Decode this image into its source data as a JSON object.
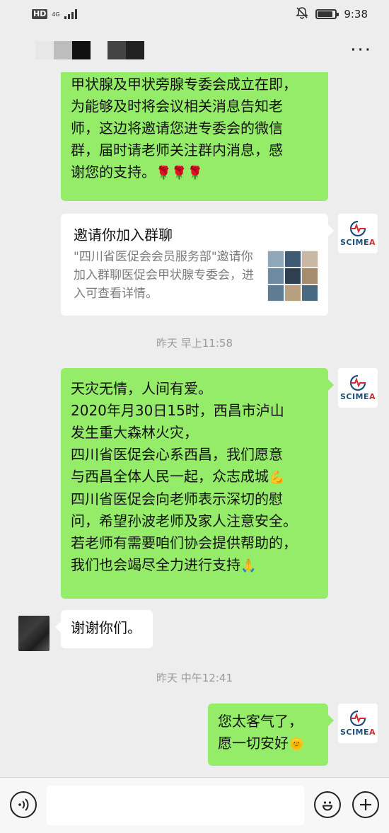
{
  "status_bar": {
    "hd_badge": "HD",
    "network_type": "4G",
    "time": "9:38",
    "battery_level": 0.8,
    "icons": [
      "hd-icon",
      "signal-icon",
      "mute-icon",
      "battery-icon"
    ]
  },
  "header": {
    "title_blurred": true,
    "more_label": "···"
  },
  "avatar_brand": {
    "text_main": "SCIME",
    "text_accent": "A",
    "brand_color": "#1d4f7c",
    "accent_color": "#d22a33"
  },
  "messages": [
    {
      "type": "text",
      "direction": "out",
      "lines": [
        "甲状腺及甲状旁腺专委会成立在即，",
        "为能够及时将会议相关消息告知老",
        "师，这边将邀请您进专委会的微信",
        "群，届时请老师关注群内消息，感",
        "谢您的支持。"
      ],
      "emoji": "🌹🌹🌹"
    },
    {
      "type": "invite_card",
      "direction": "out",
      "title": "邀请你加入群聊",
      "description": "\"四川省医促会会员服务部\"邀请你加入群聊医促会甲状腺专委会，进入可查看详情。"
    },
    {
      "type": "timestamp",
      "text": "昨天 早上11:58"
    },
    {
      "type": "text",
      "direction": "out",
      "lines": [
        "天灾无情，人间有爱。",
        "2020年月30日15时，西昌市泸山",
        "发生重大森林火灾，",
        "四川省医促会心系西昌，我们愿意",
        "与西昌全体人民一起，众志成城",
        "四川省医促会向老师表示深切的慰",
        "问，希望孙波老师及家人注意安全。",
        "若老师有需要咱们协会提供帮助的，",
        "我们也会竭尽全力进行支持"
      ],
      "emoji_line5": "💪",
      "emoji_line9": "🙏"
    },
    {
      "type": "text",
      "direction": "in",
      "lines": [
        "谢谢你们。"
      ]
    },
    {
      "type": "timestamp",
      "text": "昨天 中午12:41"
    },
    {
      "type": "text",
      "direction": "out",
      "lines": [
        "您太客气了，",
        "愿一切安好"
      ],
      "emoji_line2": "🌞"
    }
  ],
  "input_bar": {
    "voice_icon": "voice-icon",
    "emoji_icon": "emoji-icon",
    "plus_icon": "plus-icon",
    "text_value": "",
    "placeholder": ""
  }
}
